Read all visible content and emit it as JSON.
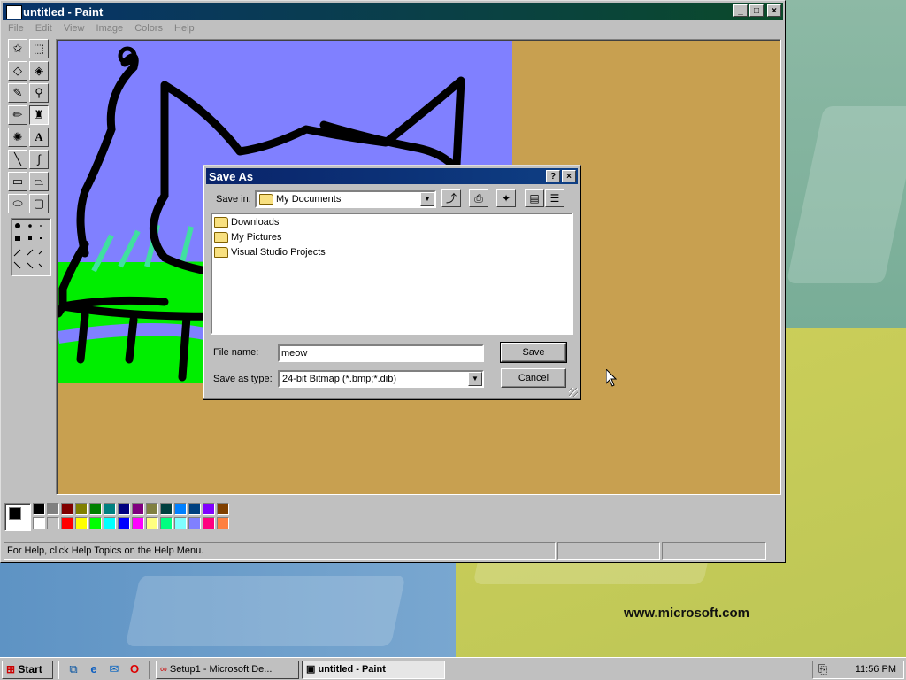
{
  "desktop": {
    "watermark": "www.microsoft.com"
  },
  "paint": {
    "title": "untitled - Paint",
    "menu": [
      "File",
      "Edit",
      "View",
      "Image",
      "Colors",
      "Help"
    ],
    "status": "For Help, click Help Topics on the Help Menu.",
    "canvas_bg": "#c8a050",
    "palette_row1": [
      "#000000",
      "#808080",
      "#800000",
      "#808000",
      "#008000",
      "#008080",
      "#000080",
      "#800080",
      "#808040",
      "#004040",
      "#0080ff",
      "#004080",
      "#8000ff",
      "#804000"
    ],
    "palette_row2": [
      "#ffffff",
      "#c0c0c0",
      "#ff0000",
      "#ffff00",
      "#00ff00",
      "#00ffff",
      "#0000ff",
      "#ff00ff",
      "#ffff80",
      "#00ff80",
      "#80ffff",
      "#8080ff",
      "#ff0080",
      "#ff8040"
    ]
  },
  "dialog": {
    "title": "Save As",
    "save_in_label": "Save in:",
    "save_in_value": "My Documents",
    "files": [
      "Downloads",
      "My Pictures",
      "Visual Studio Projects"
    ],
    "filename_label": "File name:",
    "filename_value": "meow",
    "type_label": "Save as type:",
    "type_value": "24-bit Bitmap (*.bmp;*.dib)",
    "save_button": "Save",
    "cancel_button": "Cancel"
  },
  "taskbar": {
    "start": "Start",
    "tasks": [
      "Setup1 - Microsoft De...",
      "untitled - Paint"
    ],
    "clock": "11:56 PM"
  },
  "icons": {
    "title_help": "?",
    "minimize": "_",
    "maximize": "□",
    "close": "×"
  }
}
